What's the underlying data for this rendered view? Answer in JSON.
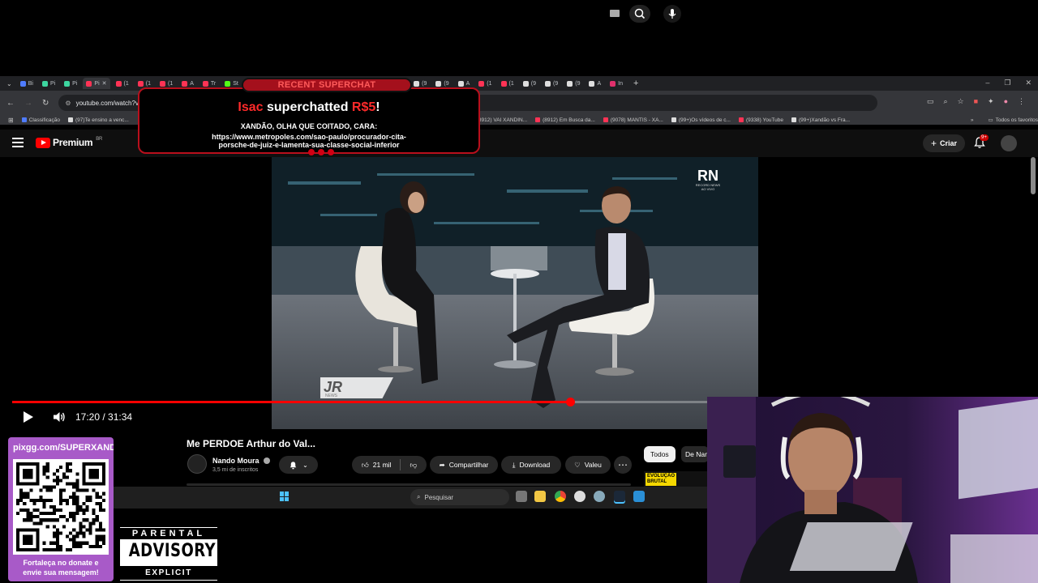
{
  "browser": {
    "tabs": [
      {
        "label": "Bi",
        "color": "#4f7cff"
      },
      {
        "label": "Pi",
        "color": "#3dd6a0"
      },
      {
        "label": "Pi",
        "color": "#3dd6a0"
      },
      {
        "label": "Pi",
        "color": "#ff3355"
      },
      {
        "label": "(1",
        "color": "#ff3355"
      },
      {
        "label": "(1",
        "color": "#ff3355"
      },
      {
        "label": "(1",
        "color": "#ff3355"
      },
      {
        "label": "A",
        "color": "#ff3355"
      },
      {
        "label": "Tr",
        "color": "#ff3355"
      },
      {
        "label": "St",
        "color": "#53fc18"
      },
      {
        "label": "Sl",
        "color": "#53fc18"
      },
      {
        "label": "Vi",
        "color": "#ffffff"
      },
      {
        "label": "",
        "color": "#ff3355"
      },
      {
        "label": "",
        "color": "#ff3355"
      },
      {
        "label": "St",
        "color": "#e1306c"
      },
      {
        "label": "In",
        "color": "#e1306c"
      },
      {
        "label": "(1",
        "color": "#ff3355"
      },
      {
        "label": "(1",
        "color": "#ff3355"
      },
      {
        "label": "(9",
        "color": "#dddddd"
      },
      {
        "label": "(9",
        "color": "#dddddd"
      },
      {
        "label": "A",
        "color": "#dddddd"
      },
      {
        "label": "(1",
        "color": "#ff3355"
      },
      {
        "label": "(1",
        "color": "#ff3355"
      },
      {
        "label": "(9",
        "color": "#dddddd"
      },
      {
        "label": "(9",
        "color": "#dddddd"
      },
      {
        "label": "(9",
        "color": "#dddddd"
      },
      {
        "label": "A",
        "color": "#dddddd"
      },
      {
        "label": "In",
        "color": "#e1306c"
      }
    ],
    "address": "youtube.com/watch?v=l",
    "bookmarks": [
      {
        "label": "Classificação",
        "color": "#4f7cff"
      },
      {
        "label": "(97)Te ensino a venc...",
        "color": "#dddddd"
      },
      {
        "label": "(8912) VAI XANDIN...",
        "color": "#ff3355"
      },
      {
        "label": "(8912) Em Busca da...",
        "color": "#ff3355"
      },
      {
        "label": "(9078) MANTIS - XA...",
        "color": "#ff3355"
      },
      {
        "label": "(99+)Os vídeos de c...",
        "color": "#dddddd"
      },
      {
        "label": "(9338) YouTube",
        "color": "#ff3355"
      },
      {
        "label": "(99+)Xandão vs Fra...",
        "color": "#dddddd"
      }
    ],
    "bookmarks_more": "»",
    "all_bookmarks": "Todos os favoritos"
  },
  "youtube": {
    "logo_text": "Premium",
    "region": "BR",
    "create_label": "Criar",
    "notifications_badge": "9+"
  },
  "superchat": {
    "tag": "RECENT SUPERCHAT",
    "user": "Isac",
    "action": " superchatted ",
    "amount": "R$5",
    "suffix": "!",
    "message_line1": "XANDÃO, OLHA QUE COITADO, CARA:",
    "message_line2": "https://www.metropoles.com/sao-paulo/procurador-cita-",
    "message_line3": "porsche-de-juiz-e-lamenta-sua-classe-social-inferior"
  },
  "video": {
    "overlay_logo_big": "RN",
    "overlay_logo_small": "RECORD NEWS",
    "overlay_live": "AO VIVO",
    "lower_logo": "JR",
    "lower_logo_sub": "NEWS",
    "time": "17:20 / 31:34",
    "progress": 0.8,
    "title": "Me PERDOE Arthur do Val...",
    "channel": "Nando Moura",
    "subscribers": "3,5 mi de inscritos",
    "likes": "21 mil",
    "share_label": "Compartilhar",
    "download_label": "Download",
    "thanks_label": "Valeu",
    "more_label": "⋯"
  },
  "sidebar_chips": {
    "all": "Todos",
    "nando": "De Nan"
  },
  "thumbnail": {
    "label_line1": "EVOLUÇÃO",
    "label_line2": "BRUTAL"
  },
  "taskbar": {
    "search_placeholder": "Pesquisar"
  },
  "overlay": {
    "donate_url": "pixgg.com/SUPERXANDA",
    "donate_caption_line1": "Fortaleça no donate e",
    "donate_caption_line2": "envie sua mensagem!",
    "advisory_top": "PARENTAL",
    "advisory_mid": "ADVISORY",
    "advisory_bottom": "EXPLICIT CONTENT"
  }
}
